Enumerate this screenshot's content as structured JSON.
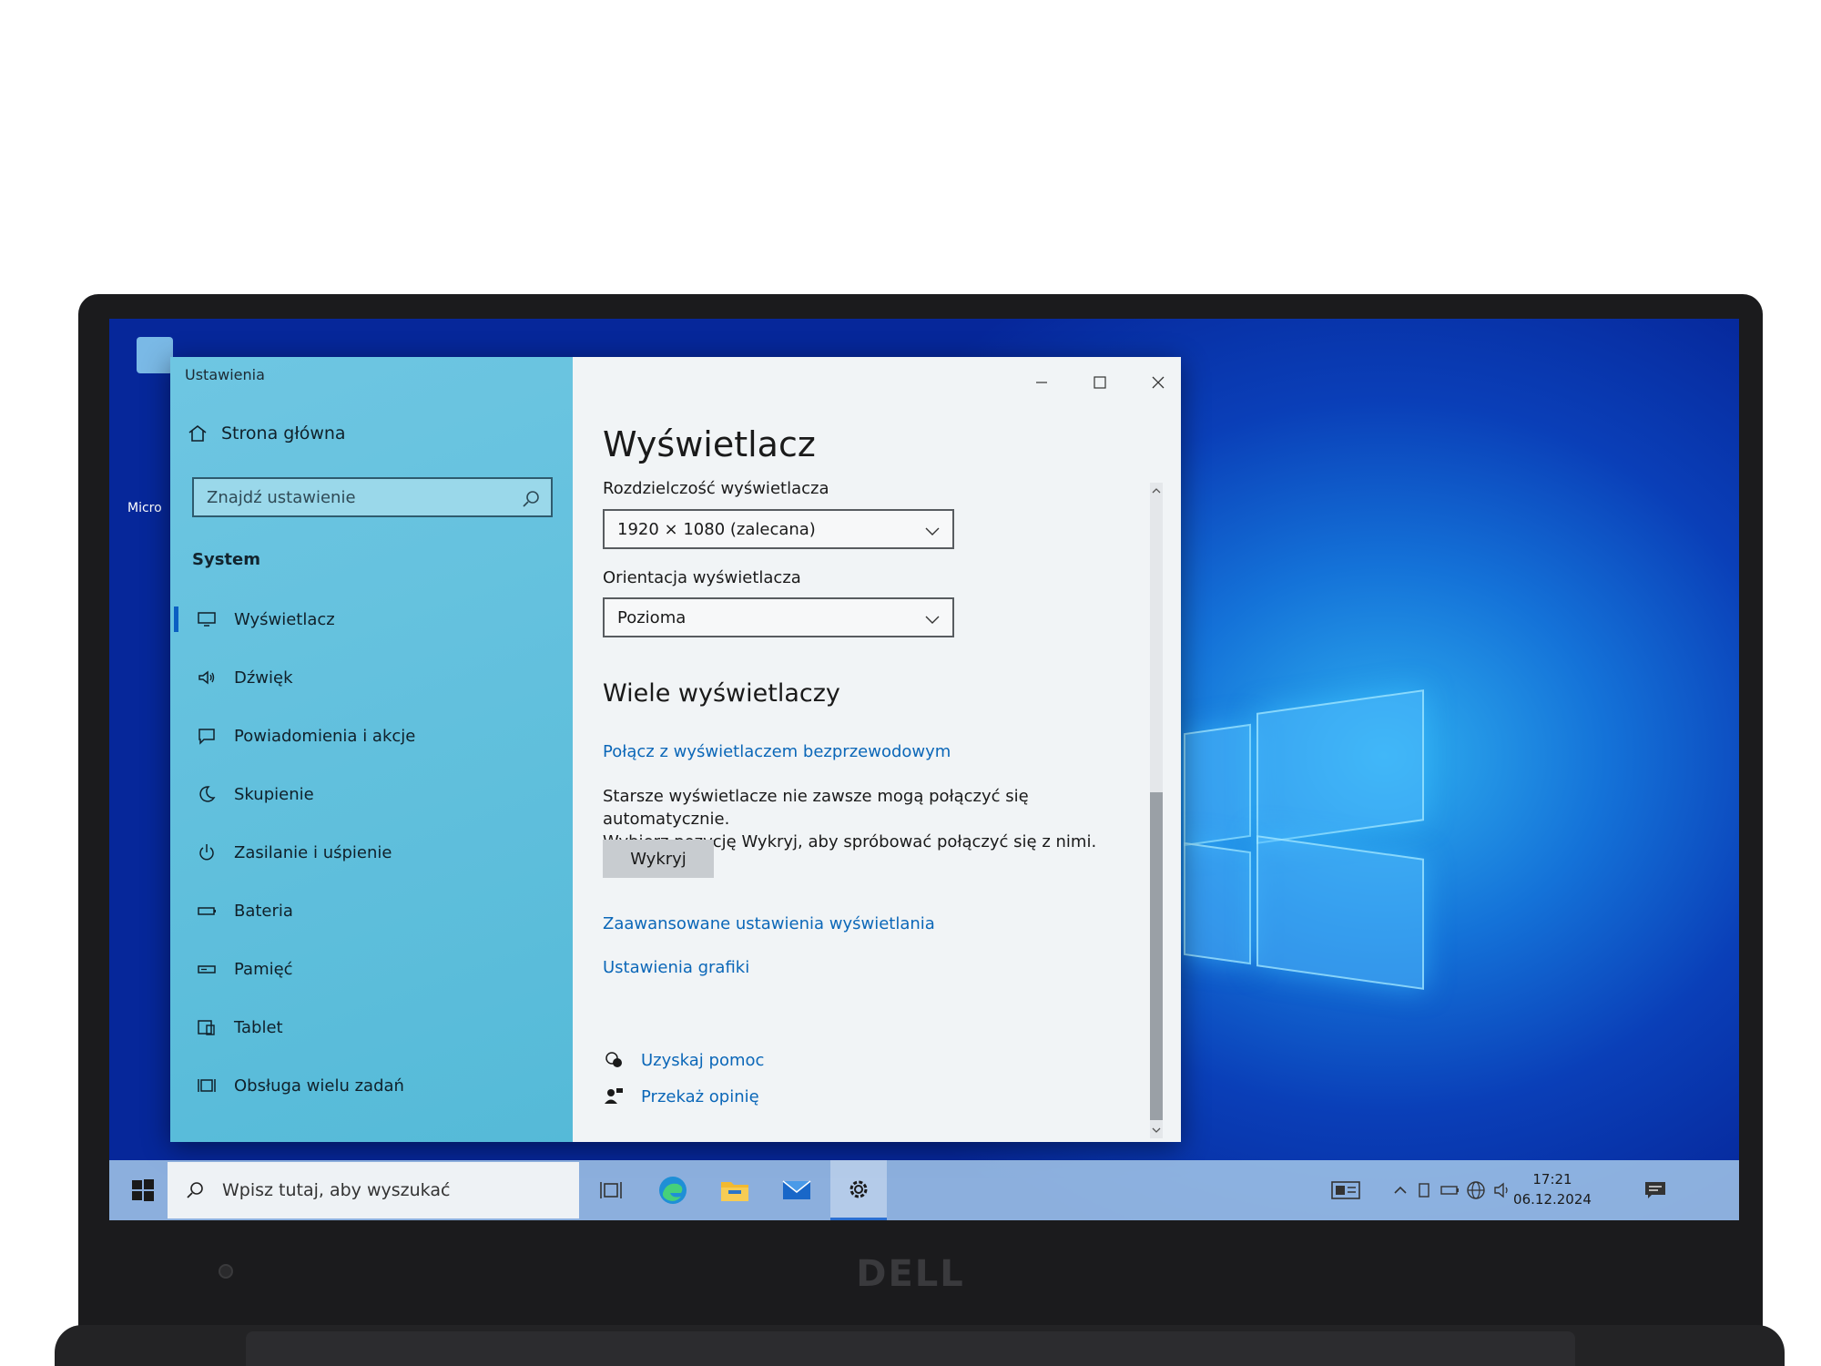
{
  "window": {
    "title": "Ustawienia"
  },
  "nav": {
    "home_label": "Strona główna",
    "search_placeholder": "Znajdź ustawienie",
    "section_title": "System",
    "items": [
      {
        "label": "Wyświetlacz",
        "icon": "monitor-icon",
        "active": true
      },
      {
        "label": "Dźwięk",
        "icon": "speaker-icon"
      },
      {
        "label": "Powiadomienia i akcje",
        "icon": "notification-icon"
      },
      {
        "label": "Skupienie",
        "icon": "moon-icon"
      },
      {
        "label": "Zasilanie i uśpienie",
        "icon": "power-icon"
      },
      {
        "label": "Bateria",
        "icon": "battery-icon"
      },
      {
        "label": "Pamięć",
        "icon": "storage-icon"
      },
      {
        "label": "Tablet",
        "icon": "tablet-icon"
      },
      {
        "label": "Obsługa wielu zadań",
        "icon": "multitasking-icon"
      }
    ]
  },
  "content": {
    "title": "Wyświetlacz",
    "resolution_label": "Rozdzielczość wyświetlacza",
    "resolution_value": "1920 × 1080 (zalecana)",
    "orientation_label": "Orientacja wyświetlacza",
    "orientation_value": "Pozioma",
    "multi_title": "Wiele wyświetlaczy",
    "wireless_link": "Połącz z wyświetlaczem bezprzewodowym",
    "detect_text_1": "Starsze wyświetlacze nie zawsze mogą połączyć się automatycznie.",
    "detect_text_2": "Wybierz pozycję Wykryj, aby spróbować połączyć się z nimi.",
    "detect_button": "Wykryj",
    "advanced_link": "Zaawansowane ustawienia wyświetlania",
    "graphics_link": "Ustawienia grafiki",
    "help_link": "Uzyskaj pomoc",
    "feedback_link": "Przekaż opinię"
  },
  "taskbar": {
    "search_placeholder": "Wpisz tutaj, aby wyszukać",
    "time": "17:21",
    "date": "06.12.2024"
  },
  "desktop": {
    "icon_label": "Micro"
  },
  "brand": {
    "logo_text": "DELL"
  }
}
